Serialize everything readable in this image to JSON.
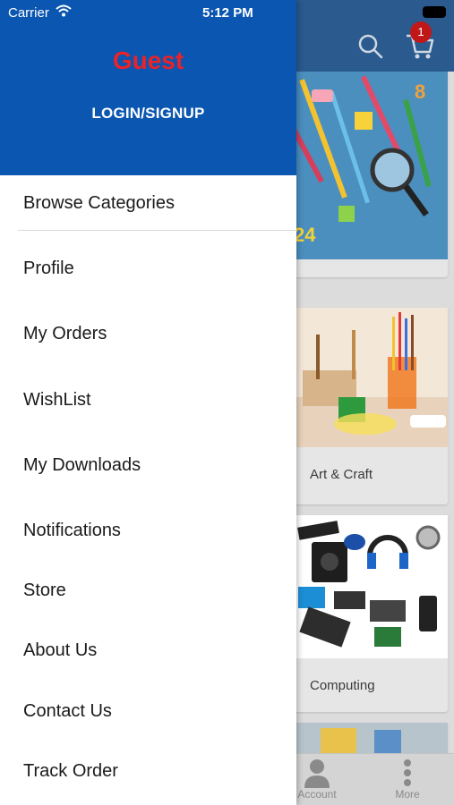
{
  "status_bar": {
    "carrier": "Carrier",
    "time": "5:12 PM"
  },
  "header": {
    "cart_count": "1"
  },
  "drawer": {
    "user_name": "Guest",
    "login_label": "LOGIN/SIGNUP",
    "menu": [
      {
        "label": "Browse Categories"
      },
      {
        "label": "Profile"
      },
      {
        "label": "My Orders"
      },
      {
        "label": "WishList"
      },
      {
        "label": "My Downloads"
      },
      {
        "label": "Notifications"
      },
      {
        "label": "Store"
      },
      {
        "label": "About Us"
      },
      {
        "label": "Contact Us"
      },
      {
        "label": "Track Order"
      }
    ]
  },
  "categories": [
    {
      "label": ""
    },
    {
      "label": "Art & Craft"
    },
    {
      "label": "Computing"
    }
  ],
  "tab_bar": {
    "tabs": [
      {
        "label": "Account",
        "icon": "person-icon"
      },
      {
        "label": "More",
        "icon": "more-dots-icon"
      }
    ]
  },
  "colors": {
    "drawer_header": "#0b56b0",
    "guest_text": "#e8232a",
    "badge": "#c01818"
  }
}
